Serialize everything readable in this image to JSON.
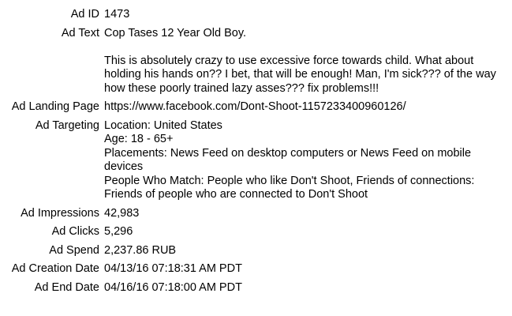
{
  "fields": [
    {
      "label": "Ad ID",
      "value": "1473"
    },
    {
      "label": "Ad Text",
      "paragraphs": [
        "Cop Tases 12 Year Old Boy.",
        "This is absolutely crazy to use excessive force towards child. What about holding his hands on?? I bet, that will be enough! Man, I'm sick??? of the way how these poorly trained lazy asses??? fix problems!!!"
      ]
    },
    {
      "label": "Ad Landing Page",
      "value": "https://www.facebook.com/Dont-Shoot-1157233400960126/"
    },
    {
      "label": "Ad Targeting",
      "lines": [
        "Location: United States",
        "Age: 18 - 65+",
        "Placements: News Feed on desktop computers or News Feed on mobile devices",
        "People Who Match: People who like Don't Shoot, Friends of connections: Friends of people who are connected to Don't Shoot"
      ]
    },
    {
      "label": "Ad Impressions",
      "value": "42,983"
    },
    {
      "label": "Ad Clicks",
      "value": "5,296"
    },
    {
      "label": "Ad Spend",
      "value": "2,237.86 RUB"
    },
    {
      "label": "Ad Creation Date",
      "value": "04/13/16 07:18:31 AM PDT"
    },
    {
      "label": "Ad End Date",
      "value": "04/16/16 07:18:00 AM PDT"
    }
  ]
}
